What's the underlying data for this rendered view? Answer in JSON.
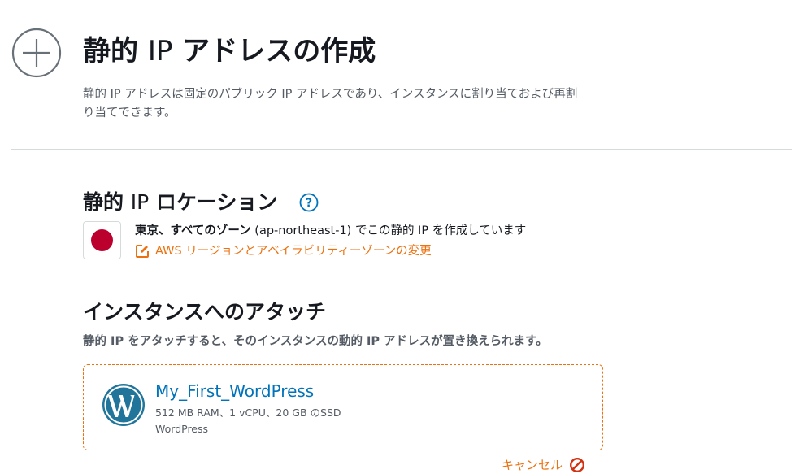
{
  "header": {
    "title_prefix": "静的",
    "title_ip": "IP",
    "title_suffix": "アドレスの作成",
    "description": "静的 IP アドレスは固定のパブリック IP アドレスであり、インスタンスに割り当ておよび再割り当てできます。"
  },
  "location": {
    "title_prefix": "静的",
    "title_ip": "IP",
    "title_suffix": "ロケーション",
    "help_icon": "question-circle-icon",
    "help_label": "?",
    "flag": "japan-flag-icon",
    "flag_color": "#bc002d",
    "region_name": "東京、すべてのゾーン",
    "region_code": "(ap-northeast-1)",
    "region_suffix": "でこの静的 IP を作成しています",
    "change_icon": "edit-icon",
    "change_link": "AWS リージョンとアベイラビリティーゾーンの変更"
  },
  "attach": {
    "title": "インスタンスへのアタッチ",
    "description": "静的 IP をアタッチすると、そのインスタンスの動的 IP アドレスが置き換えられます。",
    "instance": {
      "icon": "wordpress-icon",
      "name": "My_First_WordPress",
      "specs": "512 MB RAM、1 vCPU、20 GB のSSD",
      "blueprint": "WordPress"
    },
    "cancel_label": "キャンセル",
    "cancel_icon": "cancel-icon"
  },
  "colors": {
    "accent": "#ec7211",
    "link": "#0073bb",
    "wordpress": "#21759b"
  }
}
